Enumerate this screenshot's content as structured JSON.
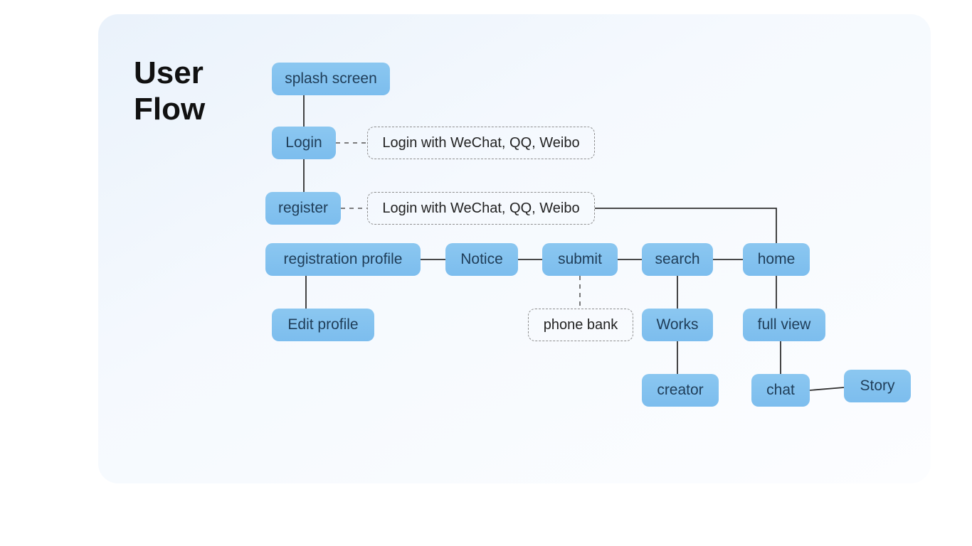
{
  "title": "User\nFlow",
  "nodes": {
    "splash": "splash screen",
    "login": "Login",
    "register": "register",
    "regprof": "registration profile",
    "editprof": "Edit profile",
    "notice": "Notice",
    "submit": "submit",
    "search": "search",
    "home": "home",
    "works": "Works",
    "fullview": "full view",
    "creator": "creator",
    "chat": "chat",
    "story": "Story"
  },
  "notes": {
    "loginNote": "Login with WeChat, QQ, Weibo",
    "registerNote": "Login with WeChat, QQ, Weibo",
    "phoneBank": "phone bank"
  }
}
